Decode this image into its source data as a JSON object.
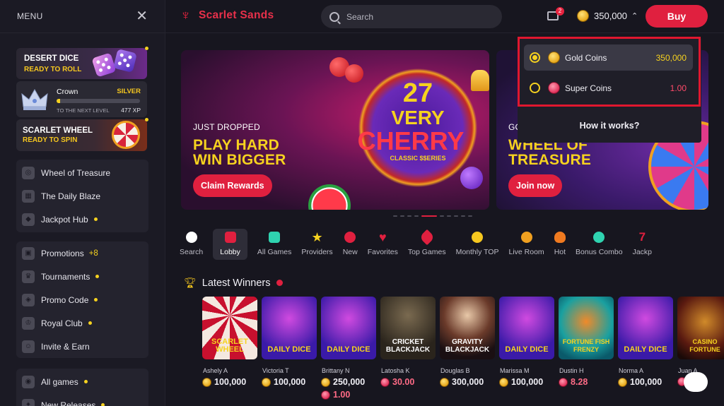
{
  "sidebar": {
    "menu_label": "MENU",
    "promos": {
      "dice": {
        "title": "DESERT DICE",
        "subtitle": "READY TO ROLL"
      },
      "crown": {
        "level": "Crown",
        "rank": "SILVER",
        "next_label": "TO THE NEXT LEVEL",
        "xp": "477 XP",
        "progress": 0.04
      },
      "wheel": {
        "title": "SCARLET WHEEL",
        "subtitle": "READY TO SPIN"
      }
    },
    "group1": [
      {
        "label": "Wheel of Treasure",
        "icon": "wheel-icon"
      },
      {
        "label": "The Daily Blaze",
        "icon": "calendar-icon"
      },
      {
        "label": "Jackpot Hub",
        "icon": "jackpot-icon"
      }
    ],
    "group2": [
      {
        "label": "Promotions",
        "icon": "gift-icon",
        "extra": "+8"
      },
      {
        "label": "Tournaments",
        "icon": "trophy-icon"
      },
      {
        "label": "Promo Code",
        "icon": "tag-icon"
      },
      {
        "label": "Royal Club",
        "icon": "crown-icon"
      },
      {
        "label": "Invite & Earn",
        "icon": "user-plus-icon"
      }
    ],
    "group3": [
      {
        "label": "All games",
        "icon": "gamepad-icon"
      },
      {
        "label": "New Releases",
        "icon": "new-icon"
      }
    ]
  },
  "header": {
    "brand": "Scarlet Sands",
    "search_placeholder": "Search",
    "mail_badge": "2",
    "balance": "350,000",
    "buy_label": "Buy"
  },
  "banners": [
    {
      "kicker": "JUST DROPPED",
      "line1": "PLAY HARD",
      "line2": "WIN BIGGER",
      "button": "Claim Rewards",
      "logo_num": "27",
      "logo_v1": "VERY",
      "logo_v2": "CHERRY",
      "logo_v3": "CLASSIC $$ERIES"
    },
    {
      "kicker": "GO",
      "line1": "WHEEL OF",
      "line2": "TREASURE",
      "button": "Join now"
    }
  ],
  "categories": [
    {
      "label": "Search",
      "icon": "search-icon",
      "color": "#ffffff"
    },
    {
      "label": "Lobby",
      "icon": "lobby-icon",
      "color": "#e0203f"
    },
    {
      "label": "All Games",
      "icon": "gamepad-icon",
      "color": "#2fd3b0"
    },
    {
      "label": "Providers",
      "icon": "star-icon",
      "color": "#f6d21f"
    },
    {
      "label": "New",
      "icon": "new-icon",
      "color": "#e0203f"
    },
    {
      "label": "Favorites",
      "icon": "heart-icon",
      "color": "#e0203f"
    },
    {
      "label": "Top Games",
      "icon": "rocket-icon",
      "color": "#e0203f"
    },
    {
      "label": "Monthly TOP",
      "icon": "medal-icon",
      "color": "#f6c71f"
    },
    {
      "label": "Live Room",
      "icon": "chips-icon",
      "color": "#f0a020"
    },
    {
      "label": "Hot",
      "icon": "flame-icon",
      "color": "#f07a20"
    },
    {
      "label": "Bonus Combo",
      "icon": "bomb-icon",
      "color": "#2fd3b0"
    },
    {
      "label": "Jackp",
      "icon": "seven-icon",
      "color": "#e0203f"
    }
  ],
  "winners": {
    "title": "Latest Winners",
    "items": [
      {
        "game": "SCARLET WHEEL",
        "name": "Ashely A",
        "amount": "100,000",
        "coin": "gold"
      },
      {
        "game": "DAILY DICE",
        "name": "Victoria T",
        "amount": "100,000",
        "coin": "gold"
      },
      {
        "game": "DAILY DICE",
        "name": "Brittany N",
        "amount": "250,000",
        "coin": "gold",
        "amount2": "1.00"
      },
      {
        "game": "CRICKET BLACKJACK",
        "name": "Latosha K",
        "amount": "30.00",
        "coin": "super"
      },
      {
        "game": "GRAVITY BLACKJACK",
        "name": "Douglas B",
        "amount": "300,000",
        "coin": "gold"
      },
      {
        "game": "DAILY DICE",
        "name": "Marissa M",
        "amount": "100,000",
        "coin": "gold"
      },
      {
        "game": "FORTUNE FISH FRENZY",
        "name": "Dustin H",
        "amount": "8.28",
        "coin": "super"
      },
      {
        "game": "DAILY DICE",
        "name": "Norma A",
        "amount": "100,000",
        "coin": "gold"
      },
      {
        "game": "CASINO FORTUNE",
        "name": "Juan A",
        "amount": "",
        "coin": "super"
      }
    ]
  },
  "coin_menu": {
    "options": [
      {
        "label": "Gold Coins",
        "value": "350,000",
        "selected": true
      },
      {
        "label": "Super Coins",
        "value": "1.00",
        "selected": false
      }
    ],
    "how_label": "How it works?"
  }
}
